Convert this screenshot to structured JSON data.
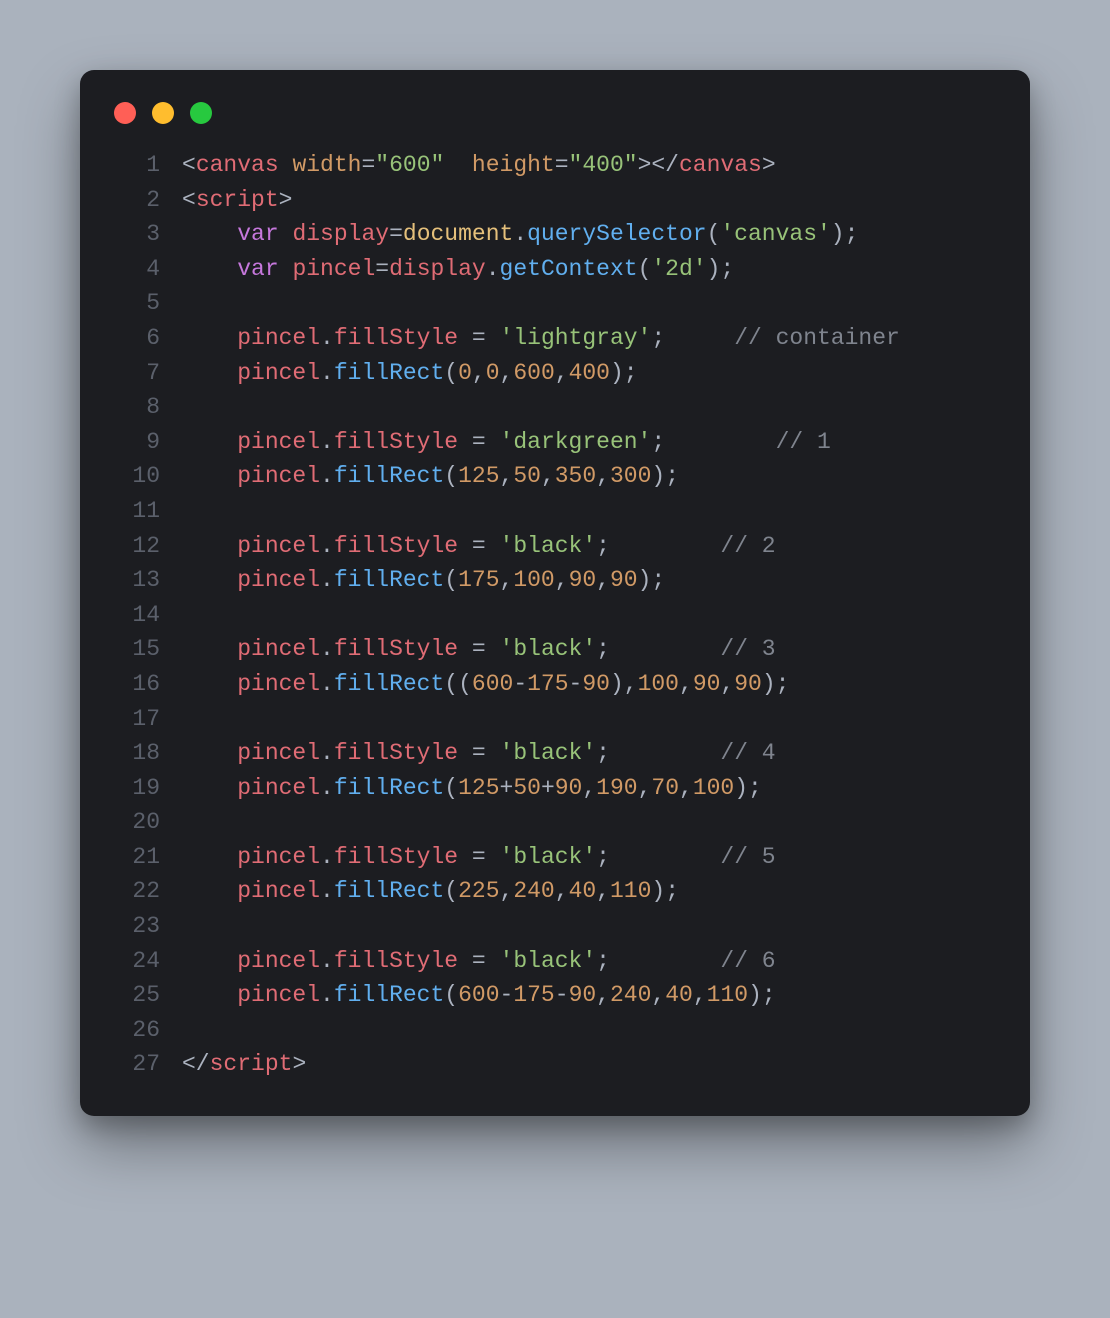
{
  "colors": {
    "background": "#aab2bd",
    "window_bg": "#1c1d21",
    "traffic_red": "#ff5f56",
    "traffic_yellow": "#ffbd2e",
    "traffic_green": "#27c93f"
  },
  "line_numbers": [
    "1",
    "2",
    "3",
    "4",
    "5",
    "6",
    "7",
    "8",
    "9",
    "10",
    "11",
    "12",
    "13",
    "14",
    "15",
    "16",
    "17",
    "18",
    "19",
    "20",
    "21",
    "22",
    "23",
    "24",
    "25",
    "26",
    "27"
  ],
  "lines": [
    [
      {
        "c": "t-punct",
        "t": "<"
      },
      {
        "c": "t-tag",
        "t": "canvas"
      },
      {
        "c": "t-default",
        "t": " "
      },
      {
        "c": "t-attr",
        "t": "width"
      },
      {
        "c": "t-punct",
        "t": "="
      },
      {
        "c": "t-string",
        "t": "\"600\""
      },
      {
        "c": "t-default",
        "t": "  "
      },
      {
        "c": "t-attr",
        "t": "height"
      },
      {
        "c": "t-punct",
        "t": "="
      },
      {
        "c": "t-string",
        "t": "\"400\""
      },
      {
        "c": "t-punct",
        "t": ">"
      },
      {
        "c": "t-punct",
        "t": "</"
      },
      {
        "c": "t-tag",
        "t": "canvas"
      },
      {
        "c": "t-punct",
        "t": ">"
      }
    ],
    [
      {
        "c": "t-punct",
        "t": "<"
      },
      {
        "c": "t-tag",
        "t": "script"
      },
      {
        "c": "t-punct",
        "t": ">"
      }
    ],
    [
      {
        "c": "t-default",
        "t": "    "
      },
      {
        "c": "t-keyword",
        "t": "var"
      },
      {
        "c": "t-default",
        "t": " "
      },
      {
        "c": "t-obj",
        "t": "display"
      },
      {
        "c": "t-punct",
        "t": "="
      },
      {
        "c": "t-var",
        "t": "document"
      },
      {
        "c": "t-punct",
        "t": "."
      },
      {
        "c": "t-func",
        "t": "querySelector"
      },
      {
        "c": "t-punct",
        "t": "("
      },
      {
        "c": "t-string",
        "t": "'canvas'"
      },
      {
        "c": "t-punct",
        "t": ");"
      }
    ],
    [
      {
        "c": "t-default",
        "t": "    "
      },
      {
        "c": "t-keyword",
        "t": "var"
      },
      {
        "c": "t-default",
        "t": " "
      },
      {
        "c": "t-obj",
        "t": "pincel"
      },
      {
        "c": "t-punct",
        "t": "="
      },
      {
        "c": "t-obj",
        "t": "display"
      },
      {
        "c": "t-punct",
        "t": "."
      },
      {
        "c": "t-func",
        "t": "getContext"
      },
      {
        "c": "t-punct",
        "t": "("
      },
      {
        "c": "t-string",
        "t": "'2d'"
      },
      {
        "c": "t-punct",
        "t": ");"
      }
    ],
    [],
    [
      {
        "c": "t-default",
        "t": "    "
      },
      {
        "c": "t-obj",
        "t": "pincel"
      },
      {
        "c": "t-punct",
        "t": "."
      },
      {
        "c": "t-prop",
        "t": "fillStyle"
      },
      {
        "c": "t-default",
        "t": " "
      },
      {
        "c": "t-punct",
        "t": "="
      },
      {
        "c": "t-default",
        "t": " "
      },
      {
        "c": "t-string",
        "t": "'lightgray'"
      },
      {
        "c": "t-punct",
        "t": ";"
      },
      {
        "c": "t-default",
        "t": "     "
      },
      {
        "c": "t-comment",
        "t": "// container"
      }
    ],
    [
      {
        "c": "t-default",
        "t": "    "
      },
      {
        "c": "t-obj",
        "t": "pincel"
      },
      {
        "c": "t-punct",
        "t": "."
      },
      {
        "c": "t-func",
        "t": "fillRect"
      },
      {
        "c": "t-punct",
        "t": "("
      },
      {
        "c": "t-num",
        "t": "0"
      },
      {
        "c": "t-punct",
        "t": ","
      },
      {
        "c": "t-num",
        "t": "0"
      },
      {
        "c": "t-punct",
        "t": ","
      },
      {
        "c": "t-num",
        "t": "600"
      },
      {
        "c": "t-punct",
        "t": ","
      },
      {
        "c": "t-num",
        "t": "400"
      },
      {
        "c": "t-punct",
        "t": ");"
      }
    ],
    [],
    [
      {
        "c": "t-default",
        "t": "    "
      },
      {
        "c": "t-obj",
        "t": "pincel"
      },
      {
        "c": "t-punct",
        "t": "."
      },
      {
        "c": "t-prop",
        "t": "fillStyle"
      },
      {
        "c": "t-default",
        "t": " "
      },
      {
        "c": "t-punct",
        "t": "="
      },
      {
        "c": "t-default",
        "t": " "
      },
      {
        "c": "t-string",
        "t": "'darkgreen'"
      },
      {
        "c": "t-punct",
        "t": ";"
      },
      {
        "c": "t-default",
        "t": "        "
      },
      {
        "c": "t-comment",
        "t": "// 1"
      }
    ],
    [
      {
        "c": "t-default",
        "t": "    "
      },
      {
        "c": "t-obj",
        "t": "pincel"
      },
      {
        "c": "t-punct",
        "t": "."
      },
      {
        "c": "t-func",
        "t": "fillRect"
      },
      {
        "c": "t-punct",
        "t": "("
      },
      {
        "c": "t-num",
        "t": "125"
      },
      {
        "c": "t-punct",
        "t": ","
      },
      {
        "c": "t-num",
        "t": "50"
      },
      {
        "c": "t-punct",
        "t": ","
      },
      {
        "c": "t-num",
        "t": "350"
      },
      {
        "c": "t-punct",
        "t": ","
      },
      {
        "c": "t-num",
        "t": "300"
      },
      {
        "c": "t-punct",
        "t": ");"
      }
    ],
    [],
    [
      {
        "c": "t-default",
        "t": "    "
      },
      {
        "c": "t-obj",
        "t": "pincel"
      },
      {
        "c": "t-punct",
        "t": "."
      },
      {
        "c": "t-prop",
        "t": "fillStyle"
      },
      {
        "c": "t-default",
        "t": " "
      },
      {
        "c": "t-punct",
        "t": "="
      },
      {
        "c": "t-default",
        "t": " "
      },
      {
        "c": "t-string",
        "t": "'black'"
      },
      {
        "c": "t-punct",
        "t": ";"
      },
      {
        "c": "t-default",
        "t": "        "
      },
      {
        "c": "t-comment",
        "t": "// 2"
      }
    ],
    [
      {
        "c": "t-default",
        "t": "    "
      },
      {
        "c": "t-obj",
        "t": "pincel"
      },
      {
        "c": "t-punct",
        "t": "."
      },
      {
        "c": "t-func",
        "t": "fillRect"
      },
      {
        "c": "t-punct",
        "t": "("
      },
      {
        "c": "t-num",
        "t": "175"
      },
      {
        "c": "t-punct",
        "t": ","
      },
      {
        "c": "t-num",
        "t": "100"
      },
      {
        "c": "t-punct",
        "t": ","
      },
      {
        "c": "t-num",
        "t": "90"
      },
      {
        "c": "t-punct",
        "t": ","
      },
      {
        "c": "t-num",
        "t": "90"
      },
      {
        "c": "t-punct",
        "t": ");"
      }
    ],
    [],
    [
      {
        "c": "t-default",
        "t": "    "
      },
      {
        "c": "t-obj",
        "t": "pincel"
      },
      {
        "c": "t-punct",
        "t": "."
      },
      {
        "c": "t-prop",
        "t": "fillStyle"
      },
      {
        "c": "t-default",
        "t": " "
      },
      {
        "c": "t-punct",
        "t": "="
      },
      {
        "c": "t-default",
        "t": " "
      },
      {
        "c": "t-string",
        "t": "'black'"
      },
      {
        "c": "t-punct",
        "t": ";"
      },
      {
        "c": "t-default",
        "t": "        "
      },
      {
        "c": "t-comment",
        "t": "// 3"
      }
    ],
    [
      {
        "c": "t-default",
        "t": "    "
      },
      {
        "c": "t-obj",
        "t": "pincel"
      },
      {
        "c": "t-punct",
        "t": "."
      },
      {
        "c": "t-func",
        "t": "fillRect"
      },
      {
        "c": "t-punct",
        "t": "(("
      },
      {
        "c": "t-num",
        "t": "600"
      },
      {
        "c": "t-punct",
        "t": "-"
      },
      {
        "c": "t-num",
        "t": "175"
      },
      {
        "c": "t-punct",
        "t": "-"
      },
      {
        "c": "t-num",
        "t": "90"
      },
      {
        "c": "t-punct",
        "t": "),"
      },
      {
        "c": "t-num",
        "t": "100"
      },
      {
        "c": "t-punct",
        "t": ","
      },
      {
        "c": "t-num",
        "t": "90"
      },
      {
        "c": "t-punct",
        "t": ","
      },
      {
        "c": "t-num",
        "t": "90"
      },
      {
        "c": "t-punct",
        "t": ");"
      }
    ],
    [],
    [
      {
        "c": "t-default",
        "t": "    "
      },
      {
        "c": "t-obj",
        "t": "pincel"
      },
      {
        "c": "t-punct",
        "t": "."
      },
      {
        "c": "t-prop",
        "t": "fillStyle"
      },
      {
        "c": "t-default",
        "t": " "
      },
      {
        "c": "t-punct",
        "t": "="
      },
      {
        "c": "t-default",
        "t": " "
      },
      {
        "c": "t-string",
        "t": "'black'"
      },
      {
        "c": "t-punct",
        "t": ";"
      },
      {
        "c": "t-default",
        "t": "        "
      },
      {
        "c": "t-comment",
        "t": "// 4"
      }
    ],
    [
      {
        "c": "t-default",
        "t": "    "
      },
      {
        "c": "t-obj",
        "t": "pincel"
      },
      {
        "c": "t-punct",
        "t": "."
      },
      {
        "c": "t-func",
        "t": "fillRect"
      },
      {
        "c": "t-punct",
        "t": "("
      },
      {
        "c": "t-num",
        "t": "125"
      },
      {
        "c": "t-punct",
        "t": "+"
      },
      {
        "c": "t-num",
        "t": "50"
      },
      {
        "c": "t-punct",
        "t": "+"
      },
      {
        "c": "t-num",
        "t": "90"
      },
      {
        "c": "t-punct",
        "t": ","
      },
      {
        "c": "t-num",
        "t": "190"
      },
      {
        "c": "t-punct",
        "t": ","
      },
      {
        "c": "t-num",
        "t": "70"
      },
      {
        "c": "t-punct",
        "t": ","
      },
      {
        "c": "t-num",
        "t": "100"
      },
      {
        "c": "t-punct",
        "t": ");"
      }
    ],
    [],
    [
      {
        "c": "t-default",
        "t": "    "
      },
      {
        "c": "t-obj",
        "t": "pincel"
      },
      {
        "c": "t-punct",
        "t": "."
      },
      {
        "c": "t-prop",
        "t": "fillStyle"
      },
      {
        "c": "t-default",
        "t": " "
      },
      {
        "c": "t-punct",
        "t": "="
      },
      {
        "c": "t-default",
        "t": " "
      },
      {
        "c": "t-string",
        "t": "'black'"
      },
      {
        "c": "t-punct",
        "t": ";"
      },
      {
        "c": "t-default",
        "t": "        "
      },
      {
        "c": "t-comment",
        "t": "// 5"
      }
    ],
    [
      {
        "c": "t-default",
        "t": "    "
      },
      {
        "c": "t-obj",
        "t": "pincel"
      },
      {
        "c": "t-punct",
        "t": "."
      },
      {
        "c": "t-func",
        "t": "fillRect"
      },
      {
        "c": "t-punct",
        "t": "("
      },
      {
        "c": "t-num",
        "t": "225"
      },
      {
        "c": "t-punct",
        "t": ","
      },
      {
        "c": "t-num",
        "t": "240"
      },
      {
        "c": "t-punct",
        "t": ","
      },
      {
        "c": "t-num",
        "t": "40"
      },
      {
        "c": "t-punct",
        "t": ","
      },
      {
        "c": "t-num",
        "t": "110"
      },
      {
        "c": "t-punct",
        "t": ");"
      }
    ],
    [],
    [
      {
        "c": "t-default",
        "t": "    "
      },
      {
        "c": "t-obj",
        "t": "pincel"
      },
      {
        "c": "t-punct",
        "t": "."
      },
      {
        "c": "t-prop",
        "t": "fillStyle"
      },
      {
        "c": "t-default",
        "t": " "
      },
      {
        "c": "t-punct",
        "t": "="
      },
      {
        "c": "t-default",
        "t": " "
      },
      {
        "c": "t-string",
        "t": "'black'"
      },
      {
        "c": "t-punct",
        "t": ";"
      },
      {
        "c": "t-default",
        "t": "        "
      },
      {
        "c": "t-comment",
        "t": "// 6"
      }
    ],
    [
      {
        "c": "t-default",
        "t": "    "
      },
      {
        "c": "t-obj",
        "t": "pincel"
      },
      {
        "c": "t-punct",
        "t": "."
      },
      {
        "c": "t-func",
        "t": "fillRect"
      },
      {
        "c": "t-punct",
        "t": "("
      },
      {
        "c": "t-num",
        "t": "600"
      },
      {
        "c": "t-punct",
        "t": "-"
      },
      {
        "c": "t-num",
        "t": "175"
      },
      {
        "c": "t-punct",
        "t": "-"
      },
      {
        "c": "t-num",
        "t": "90"
      },
      {
        "c": "t-punct",
        "t": ","
      },
      {
        "c": "t-num",
        "t": "240"
      },
      {
        "c": "t-punct",
        "t": ","
      },
      {
        "c": "t-num",
        "t": "40"
      },
      {
        "c": "t-punct",
        "t": ","
      },
      {
        "c": "t-num",
        "t": "110"
      },
      {
        "c": "t-punct",
        "t": ");"
      }
    ],
    [],
    [
      {
        "c": "t-punct",
        "t": "</"
      },
      {
        "c": "t-tag",
        "t": "script"
      },
      {
        "c": "t-punct",
        "t": ">"
      }
    ]
  ]
}
